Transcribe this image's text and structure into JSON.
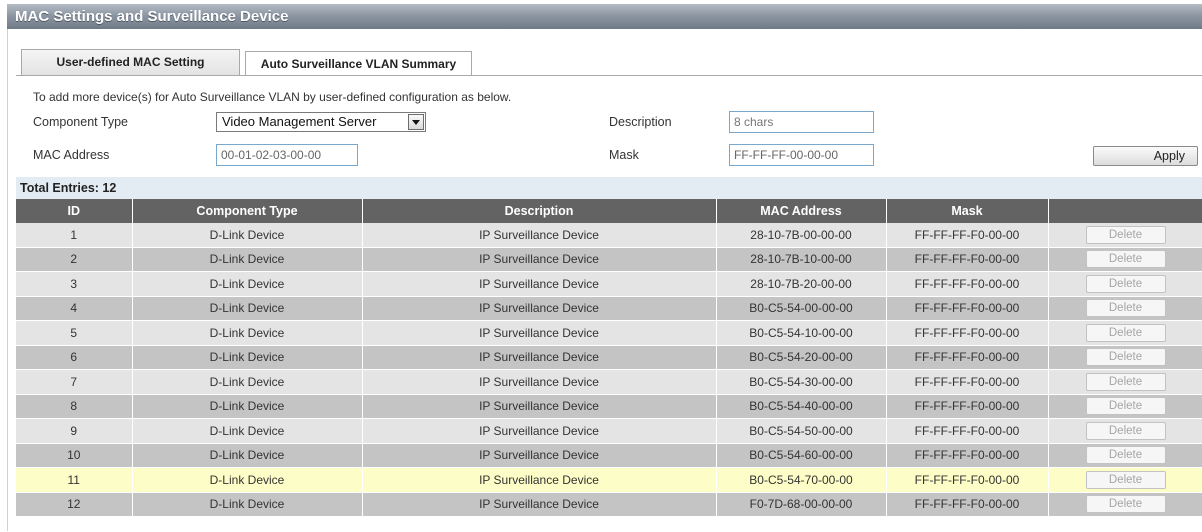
{
  "header": {
    "title": "MAC Settings and Surveillance Device"
  },
  "tabs": [
    {
      "label": "User-defined MAC Setting"
    },
    {
      "label": "Auto Surveillance VLAN Summary"
    }
  ],
  "form": {
    "intro": "To add more device(s) for Auto Surveillance VLAN by user-defined configuration as below.",
    "component_type_label": "Component Type",
    "component_type_value": "Video Management Server",
    "description_label": "Description",
    "description_placeholder": "8 chars",
    "mac_label": "MAC Address",
    "mac_value": "00-01-02-03-00-00",
    "mask_label": "Mask",
    "mask_value": "FF-FF-FF-00-00-00",
    "apply_label": "Apply"
  },
  "table": {
    "total_label": "Total Entries: 12",
    "columns": [
      "ID",
      "Component Type",
      "Description",
      "MAC Address",
      "Mask",
      ""
    ],
    "delete_label": "Delete",
    "rows": [
      [
        "1",
        "D-Link Device",
        "IP Surveillance Device",
        "28-10-7B-00-00-00",
        "FF-FF-FF-F0-00-00"
      ],
      [
        "2",
        "D-Link Device",
        "IP Surveillance Device",
        "28-10-7B-10-00-00",
        "FF-FF-FF-F0-00-00"
      ],
      [
        "3",
        "D-Link Device",
        "IP Surveillance Device",
        "28-10-7B-20-00-00",
        "FF-FF-FF-F0-00-00"
      ],
      [
        "4",
        "D-Link Device",
        "IP Surveillance Device",
        "B0-C5-54-00-00-00",
        "FF-FF-FF-F0-00-00"
      ],
      [
        "5",
        "D-Link Device",
        "IP Surveillance Device",
        "B0-C5-54-10-00-00",
        "FF-FF-FF-F0-00-00"
      ],
      [
        "6",
        "D-Link Device",
        "IP Surveillance Device",
        "B0-C5-54-20-00-00",
        "FF-FF-FF-F0-00-00"
      ],
      [
        "7",
        "D-Link Device",
        "IP Surveillance Device",
        "B0-C5-54-30-00-00",
        "FF-FF-FF-F0-00-00"
      ],
      [
        "8",
        "D-Link Device",
        "IP Surveillance Device",
        "B0-C5-54-40-00-00",
        "FF-FF-FF-F0-00-00"
      ],
      [
        "9",
        "D-Link Device",
        "IP Surveillance Device",
        "B0-C5-54-50-00-00",
        "FF-FF-FF-F0-00-00"
      ],
      [
        "10",
        "D-Link Device",
        "IP Surveillance Device",
        "B0-C5-54-60-00-00",
        "FF-FF-FF-F0-00-00"
      ],
      [
        "11",
        "D-Link Device",
        "IP Surveillance Device",
        "B0-C5-54-70-00-00",
        "FF-FF-FF-F0-00-00"
      ],
      [
        "12",
        "D-Link Device",
        "IP Surveillance Device",
        "F0-7D-68-00-00-00",
        "FF-FF-FF-F0-00-00"
      ]
    ]
  }
}
